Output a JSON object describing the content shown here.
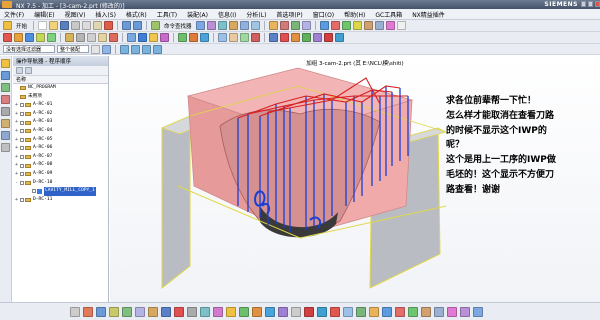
{
  "titlebar": {
    "title": "NX 7.5 - 加工 - [3-cam-2.prt (修改的)]",
    "brand": "SIEMENS"
  },
  "menu": [
    "文件(F)",
    "编辑(E)",
    "视图(V)",
    "插入(S)",
    "格式(R)",
    "工具(T)",
    "装配(A)",
    "信息(I)",
    "分析(L)",
    "首选项(P)",
    "窗口(O)",
    "帮助(H)",
    "GC工具箱",
    "NX精益插件"
  ],
  "toolbar": {
    "start_label": "开始",
    "command_finder_label": "命令查找器",
    "selection_filter": "没有选择过滤器",
    "assembly_scope": "整个装配"
  },
  "nav": {
    "header": "操作导航器 - 程序顺序",
    "column_name": "名称",
    "rows": [
      {
        "text": "NC_PROGRAM",
        "level": 0,
        "pm": ""
      },
      {
        "text": "未用项",
        "level": 0,
        "pm": ""
      },
      {
        "text": "A-RC-01",
        "level": 0,
        "pm": "+"
      },
      {
        "text": "A-RC-02",
        "level": 0,
        "pm": "+"
      },
      {
        "text": "A-RC-03",
        "level": 0,
        "pm": "+"
      },
      {
        "text": "A-RC-04",
        "level": 0,
        "pm": "+"
      },
      {
        "text": "A-RC-05",
        "level": 0,
        "pm": "+"
      },
      {
        "text": "A-RC-06",
        "level": 0,
        "pm": "+"
      },
      {
        "text": "A-RC-07",
        "level": 0,
        "pm": "+"
      },
      {
        "text": "A-RC-08",
        "level": 0,
        "pm": "+"
      },
      {
        "text": "A-RC-09",
        "level": 0,
        "pm": "+"
      },
      {
        "text": "D-RC-10",
        "level": 0,
        "pm": "-"
      },
      {
        "text": "CAVITY_MILL_COPY_1",
        "level": 1,
        "pm": "",
        "selected": true
      },
      {
        "text": "D-RC-11",
        "level": 0,
        "pm": "+"
      }
    ]
  },
  "viewport": {
    "title": "加组 3-cam-2.prt (其 E:\\NCL\\模\\shiti)"
  },
  "question": {
    "lines": [
      "求各位前辈帮一下忙！",
      "怎么样才能取消在查看刀路",
      "的时候不显示这个IWP的",
      "呢？",
      "这个是用上一工序的IWP做",
      "毛坯的！这个显示不方便刀",
      "路查看！谢谢"
    ]
  },
  "colors": {
    "part_pink": "#f2b4b4",
    "tool_path_blue": "#1a3fd6",
    "tool_path_red": "#d62020",
    "wall_gray": "#b9bcc2"
  }
}
